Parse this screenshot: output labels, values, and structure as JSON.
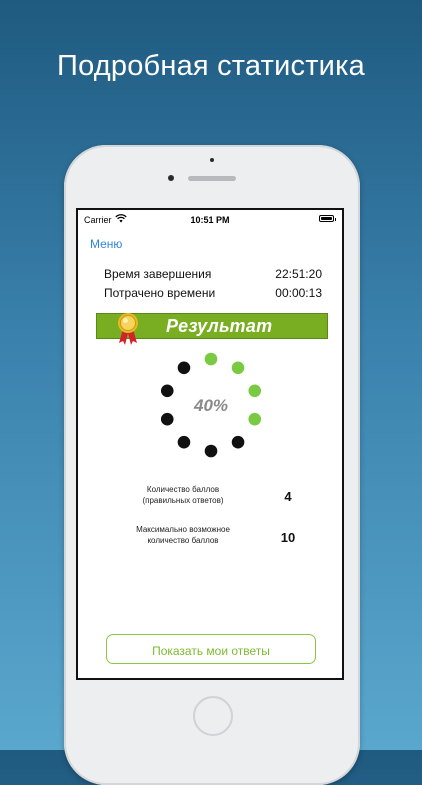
{
  "headline": "Подробная статистика",
  "status_bar": {
    "carrier": "Carrier",
    "time": "10:51 PM"
  },
  "nav": {
    "menu_label": "Меню"
  },
  "summary": {
    "end_time_label": "Время завершения",
    "end_time_value": "22:51:20",
    "spent_label": "Потрачено времени",
    "spent_value": "00:00:13"
  },
  "result": {
    "title": "Результат",
    "percent_label": "40%",
    "percent": 40,
    "dots_total": 10,
    "dots_filled": 4,
    "filled_color": "#7ac943",
    "empty_color": "#111111",
    "banner_color": "#79ad22"
  },
  "stats": {
    "score_label_line1": "Количество баллов",
    "score_label_line2": "(правильных ответов)",
    "score_value": "4",
    "max_label_line1": "Максимально возможное",
    "max_label_line2": "количество баллов",
    "max_value": "10"
  },
  "actions": {
    "show_answers_label": "Показать мои ответы"
  },
  "icons": [
    "wifi-icon",
    "battery-icon",
    "medal-icon"
  ]
}
